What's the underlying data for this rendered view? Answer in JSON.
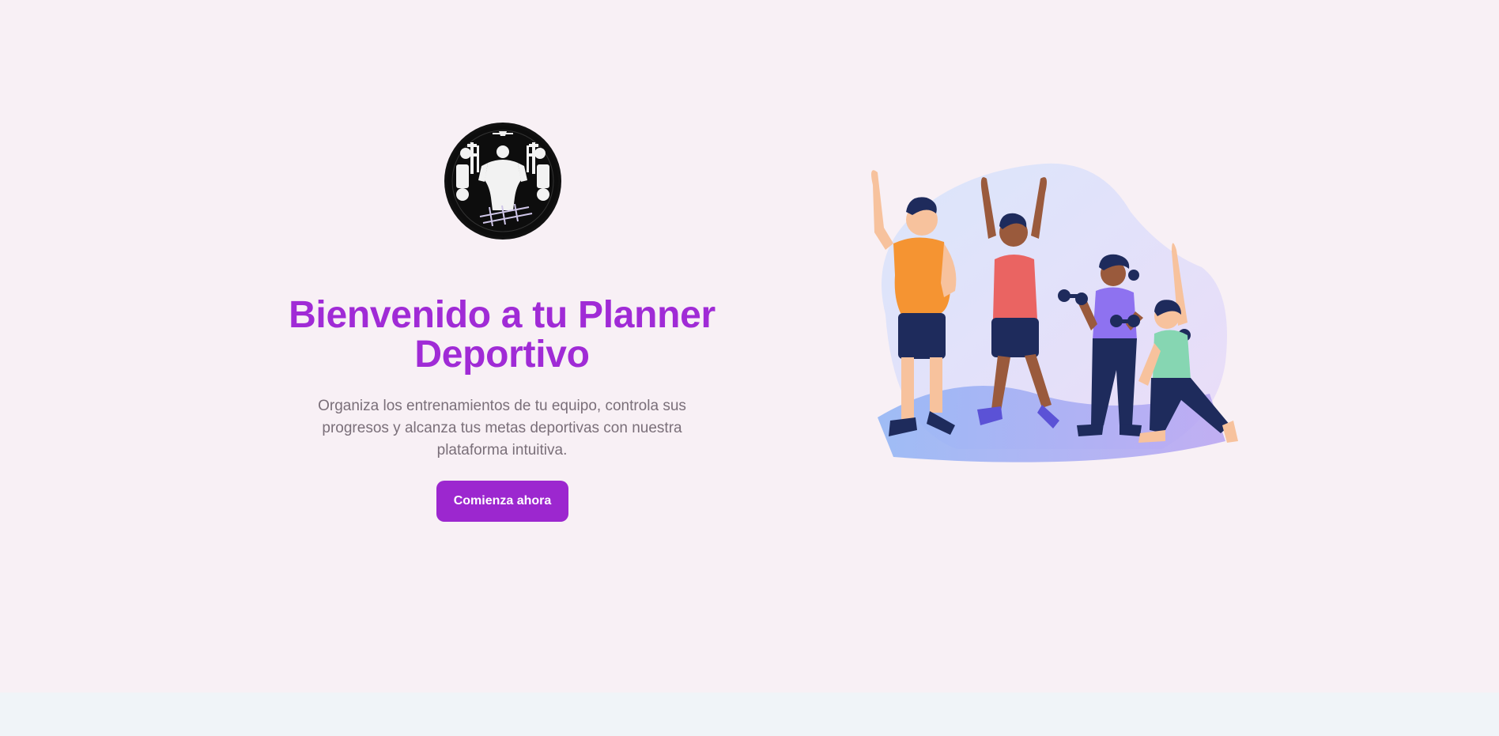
{
  "hero": {
    "title": "Bienvenido a tu Planner Deportivo",
    "subtitle": "Organiza los entrenamientos de tu equipo, controla sus progresos y alcanza tus metas deportivas con nuestra plataforma intuitiva.",
    "cta_label": "Comienza ahora"
  },
  "icons": {
    "logo": "fitness-logo-icon",
    "illustration": "team-exercise-illustration"
  },
  "colors": {
    "background": "#f8f0f5",
    "footer_band": "#f0f4f8",
    "accent": "#9c27cf",
    "title": "#a02bd6",
    "subtitle": "#7a6f79"
  }
}
